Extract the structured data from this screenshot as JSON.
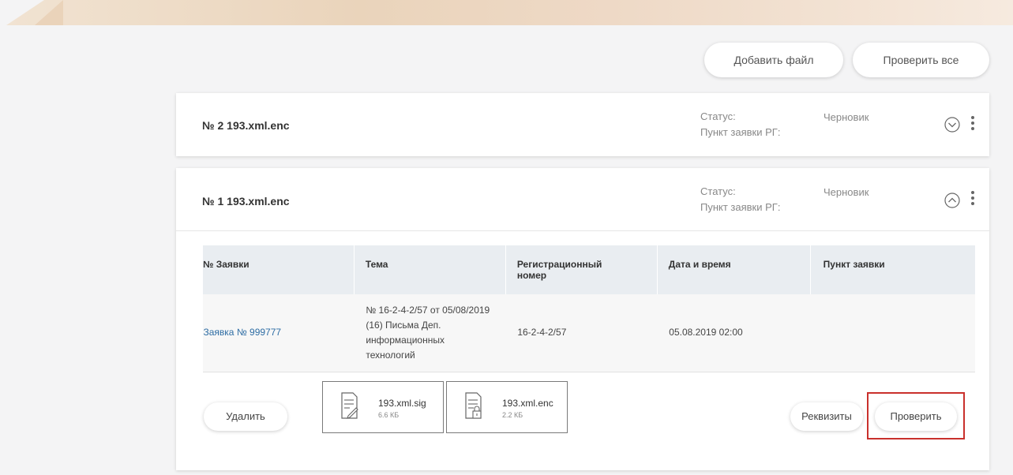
{
  "toolbar": {
    "add_file_label": "Добавить файл",
    "check_all_label": "Проверить все"
  },
  "cards": [
    {
      "title": "№ 2  193.xml.enc",
      "status_label": "Статус:",
      "point_label": "Пункт заявки РГ:",
      "status_value": "Черновик",
      "expanded": false
    },
    {
      "title": "№ 1  193.xml.enc",
      "status_label": "Статус:",
      "point_label": "Пункт заявки РГ:",
      "status_value": "Черновик",
      "expanded": true,
      "table": {
        "headers": [
          "№ Заявки",
          "Тема",
          "Регистрационный номер",
          "Дата и время",
          "Пункт заявки"
        ],
        "rows": [
          {
            "request": "Заявка № 999777",
            "topic": "№ 16-2-4-2/57 от 05/08/2019 (16) Письма Деп. информационных технологий",
            "reg_number": "16-2-4-2/57",
            "datetime": "05.08.2019 02:00",
            "point": ""
          }
        ]
      },
      "files": [
        {
          "name": "193.xml.sig",
          "size": "6.6 КБ",
          "icon": "signed-document-icon"
        },
        {
          "name": "193.xml.enc",
          "size": "2.2 КБ",
          "icon": "encrypted-document-icon"
        }
      ],
      "delete_label": "Удалить",
      "details_label": "Реквизиты",
      "check_label": "Проверить"
    }
  ],
  "colors": {
    "link": "#2e6da4",
    "highlight": "#c9302c",
    "table_header": "#e9edf1"
  }
}
